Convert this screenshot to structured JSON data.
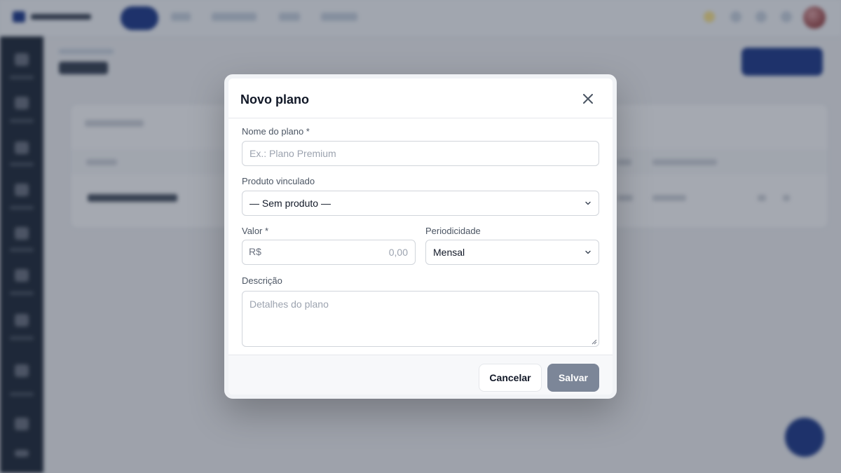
{
  "modal": {
    "title": "Novo plano",
    "close_icon": "close-icon",
    "fields": {
      "plan_name": {
        "label": "Nome do plano *",
        "value": "",
        "placeholder": "Ex.: Plano Premium"
      },
      "linked_product": {
        "label": "Produto vinculado",
        "selected": "— Sem produto —"
      },
      "amount": {
        "label": "Valor *",
        "currency": "R$",
        "value": "",
        "placeholder": "0,00"
      },
      "periodicity": {
        "label": "Periodicidade",
        "selected": "Mensal"
      },
      "description": {
        "label": "Descrição",
        "value": "",
        "placeholder": "Detalhes do plano"
      }
    },
    "footer": {
      "cancel_label": "Cancelar",
      "save_label": "Salvar"
    }
  },
  "colors": {
    "brand": "#1e3a8a",
    "save_button_disabled": "#7c8698",
    "overlay": "rgba(30,41,59,0.40)"
  }
}
